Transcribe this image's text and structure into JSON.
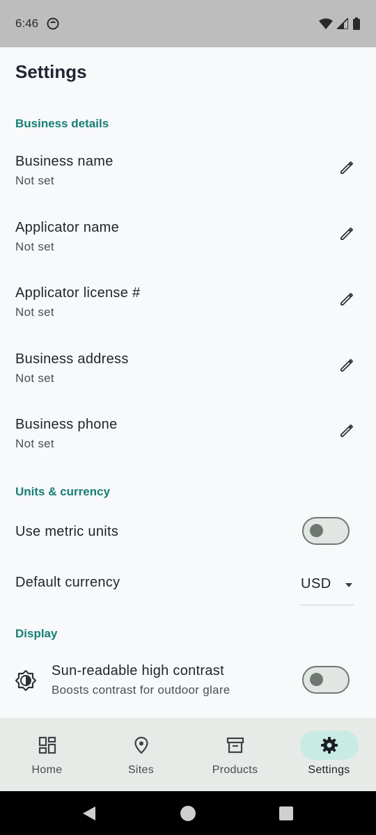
{
  "status_bar": {
    "time": "6:46",
    "icons": [
      "face-icon",
      "wifi-icon",
      "signal-icon",
      "battery-icon"
    ]
  },
  "page": {
    "title": "Settings"
  },
  "sections": {
    "business": {
      "header": "Business details",
      "items": [
        {
          "label": "Business name",
          "value": "Not set"
        },
        {
          "label": "Applicator name",
          "value": "Not set"
        },
        {
          "label": "Applicator license #",
          "value": "Not set"
        },
        {
          "label": "Business address",
          "value": "Not set"
        },
        {
          "label": "Business phone",
          "value": "Not set"
        }
      ]
    },
    "units": {
      "header": "Units & currency",
      "metric_label": "Use metric units",
      "metric_enabled": false,
      "currency_label": "Default currency",
      "currency_value": "USD"
    },
    "display": {
      "header": "Display",
      "contrast_label": "Sun-readable high contrast",
      "contrast_sub": "Boosts contrast for outdoor glare",
      "contrast_enabled": false
    }
  },
  "bottom_nav": {
    "items": [
      {
        "label": "Home",
        "icon": "dashboard-icon"
      },
      {
        "label": "Sites",
        "icon": "location-pin-icon"
      },
      {
        "label": "Products",
        "icon": "archive-box-icon"
      },
      {
        "label": "Settings",
        "icon": "gear-icon",
        "active": true
      }
    ]
  },
  "colors": {
    "accent": "#177e74",
    "active_pill": "#c8ebe3",
    "nav_bg": "#e6ebe8",
    "page_bg": "#f7f9fb"
  }
}
